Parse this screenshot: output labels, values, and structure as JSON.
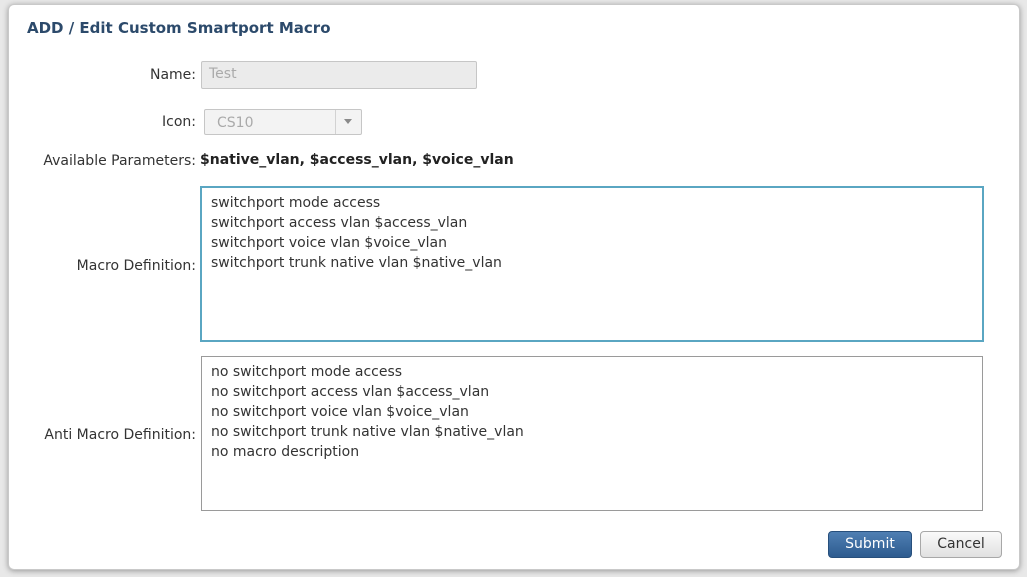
{
  "dialog": {
    "title": "ADD / Edit Custom Smartport Macro"
  },
  "form": {
    "name_label": "Name:",
    "name_value": "Test",
    "icon_label": "Icon:",
    "icon_value": "CS10",
    "params_label": "Available Parameters:",
    "params_value": "$native_vlan, $access_vlan, $voice_vlan",
    "macro_label": "Macro Definition:",
    "macro_lines": [
      "switchport mode access",
      "switchport access vlan $access_vlan",
      "switchport voice vlan $voice_vlan",
      "switchport trunk native vlan $native_vlan"
    ],
    "anti_macro_label": "Anti Macro Definition:",
    "anti_macro_lines": [
      "no switchport mode access",
      "no switchport access vlan $access_vlan",
      "no switchport voice vlan $voice_vlan",
      "no switchport trunk native vlan $native_vlan",
      "no macro description"
    ]
  },
  "buttons": {
    "submit_label": "Submit",
    "cancel_label": "Cancel"
  },
  "colors": {
    "title": "#2c4a6b",
    "focus_border": "#5aa6c2",
    "submit_bg": "#3a6aa0"
  }
}
